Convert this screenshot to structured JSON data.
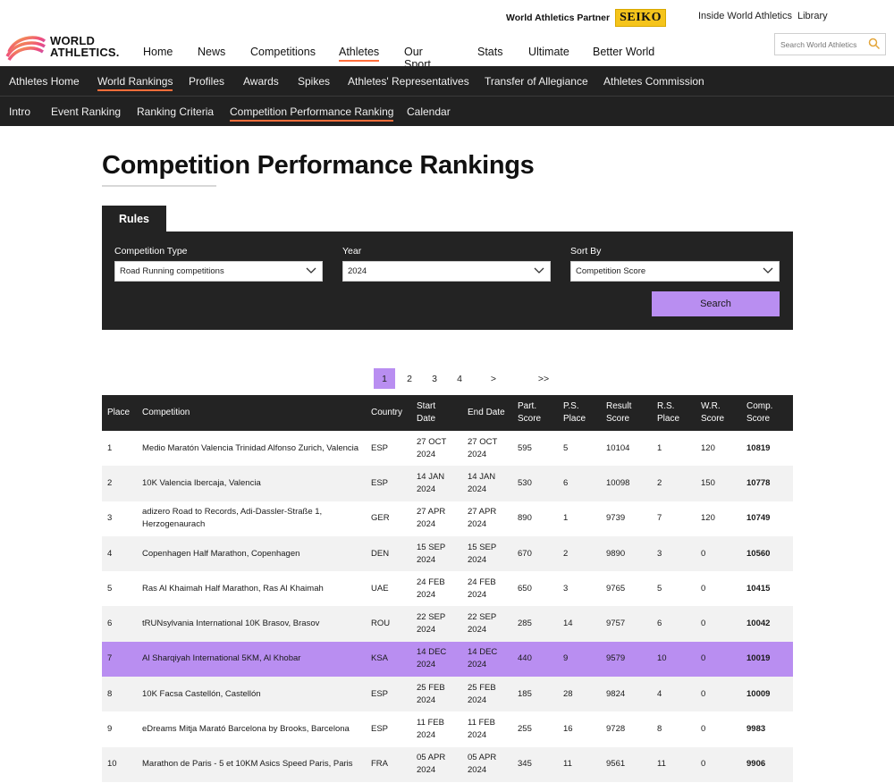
{
  "header": {
    "partner_label": "World Athletics Partner",
    "partner_brand": "SEIKO",
    "util_links": [
      "Inside World Athletics",
      "Library"
    ],
    "logo_line1": "WORLD",
    "logo_line2": "ATHLETICS.",
    "search_placeholder": "Search World Athletics",
    "nav": [
      {
        "label": "Home"
      },
      {
        "label": "News"
      },
      {
        "label": "Competitions"
      },
      {
        "label": "Athletes",
        "active": true
      },
      {
        "label": "Our Sport"
      },
      {
        "label": "Stats"
      },
      {
        "label": "Ultimate"
      },
      {
        "label": "Better World"
      }
    ]
  },
  "subnav1": [
    {
      "label": "Athletes Home"
    },
    {
      "label": "World Rankings",
      "active": true
    },
    {
      "label": "Profiles"
    },
    {
      "label": "Awards"
    },
    {
      "label": "Spikes"
    },
    {
      "label": "Athletes' Representatives"
    },
    {
      "label": "Transfer of Allegiance"
    },
    {
      "label": "Athletes Commission"
    }
  ],
  "subnav2": [
    {
      "label": "Intro"
    },
    {
      "label": "Event Ranking"
    },
    {
      "label": "Ranking Criteria"
    },
    {
      "label": "Competition Performance Ranking",
      "active": true
    },
    {
      "label": "Calendar"
    }
  ],
  "page_title": "Competition Performance Rankings",
  "filters": {
    "tab_label": "Rules",
    "competition_type_label": "Competition Type",
    "competition_type_value": "Road Running competitions",
    "year_label": "Year",
    "year_value": "2024",
    "sort_by_label": "Sort By",
    "sort_by_value": "Competition Score",
    "search_button": "Search"
  },
  "pagination": {
    "pages": [
      "1",
      "2",
      "3",
      "4",
      ">",
      ">>"
    ],
    "current": "1"
  },
  "table": {
    "headers": [
      "Place",
      "Competition",
      "Country",
      "Start Date",
      "End Date",
      "Part. Score",
      "P.S. Place",
      "Result Score",
      "R.S. Place",
      "W.R. Score",
      "Comp. Score"
    ],
    "rows": [
      {
        "place": "1",
        "competition": "Medio Maratón Valencia Trinidad Alfonso Zurich, Valencia",
        "country": "ESP",
        "start": "27 OCT 2024",
        "end": "27 OCT 2024",
        "part_score": "595",
        "ps_place": "5",
        "result_score": "10104",
        "rs_place": "1",
        "wr_score": "120",
        "comp_score": "10819"
      },
      {
        "place": "2",
        "competition": "10K Valencia Ibercaja, Valencia",
        "country": "ESP",
        "start": "14 JAN 2024",
        "end": "14 JAN 2024",
        "part_score": "530",
        "ps_place": "6",
        "result_score": "10098",
        "rs_place": "2",
        "wr_score": "150",
        "comp_score": "10778"
      },
      {
        "place": "3",
        "competition": "adizero Road to Records, Adi-Dassler-Straße 1, Herzogenaurach",
        "country": "GER",
        "start": "27 APR 2024",
        "end": "27 APR 2024",
        "part_score": "890",
        "ps_place": "1",
        "result_score": "9739",
        "rs_place": "7",
        "wr_score": "120",
        "comp_score": "10749"
      },
      {
        "place": "4",
        "competition": "Copenhagen Half Marathon, Copenhagen",
        "country": "DEN",
        "start": "15 SEP 2024",
        "end": "15 SEP 2024",
        "part_score": "670",
        "ps_place": "2",
        "result_score": "9890",
        "rs_place": "3",
        "wr_score": "0",
        "comp_score": "10560"
      },
      {
        "place": "5",
        "competition": "Ras Al Khaimah Half Marathon, Ras Al Khaimah",
        "country": "UAE",
        "start": "24 FEB 2024",
        "end": "24 FEB 2024",
        "part_score": "650",
        "ps_place": "3",
        "result_score": "9765",
        "rs_place": "5",
        "wr_score": "0",
        "comp_score": "10415"
      },
      {
        "place": "6",
        "competition": "tRUNsylvania International 10K Brasov, Brasov",
        "country": "ROU",
        "start": "22 SEP 2024",
        "end": "22 SEP 2024",
        "part_score": "285",
        "ps_place": "14",
        "result_score": "9757",
        "rs_place": "6",
        "wr_score": "0",
        "comp_score": "10042"
      },
      {
        "place": "7",
        "competition": "Al Sharqiyah International 5KM, Al Khobar",
        "country": "KSA",
        "start": "14 DEC 2024",
        "end": "14 DEC 2024",
        "part_score": "440",
        "ps_place": "9",
        "result_score": "9579",
        "rs_place": "10",
        "wr_score": "0",
        "comp_score": "10019",
        "highlight": true
      },
      {
        "place": "8",
        "competition": "10K Facsa Castellón, Castellón",
        "country": "ESP",
        "start": "25 FEB 2024",
        "end": "25 FEB 2024",
        "part_score": "185",
        "ps_place": "28",
        "result_score": "9824",
        "rs_place": "4",
        "wr_score": "0",
        "comp_score": "10009"
      },
      {
        "place": "9",
        "competition": "eDreams Mitja Marató Barcelona by Brooks, Barcelona",
        "country": "ESP",
        "start": "11 FEB 2024",
        "end": "11 FEB 2024",
        "part_score": "255",
        "ps_place": "16",
        "result_score": "9728",
        "rs_place": "8",
        "wr_score": "0",
        "comp_score": "9983"
      },
      {
        "place": "10",
        "competition": "Marathon de Paris - 5 et 10KM Asics Speed Paris, Paris",
        "country": "FRA",
        "start": "05 APR 2024",
        "end": "05 APR 2024",
        "part_score": "345",
        "ps_place": "11",
        "result_score": "9561",
        "rs_place": "11",
        "wr_score": "0",
        "comp_score": "9906"
      }
    ]
  },
  "colors": {
    "accent_purple": "#b98ef1",
    "nav_underline": "#ff6d3a",
    "dark_bar": "#212121"
  }
}
